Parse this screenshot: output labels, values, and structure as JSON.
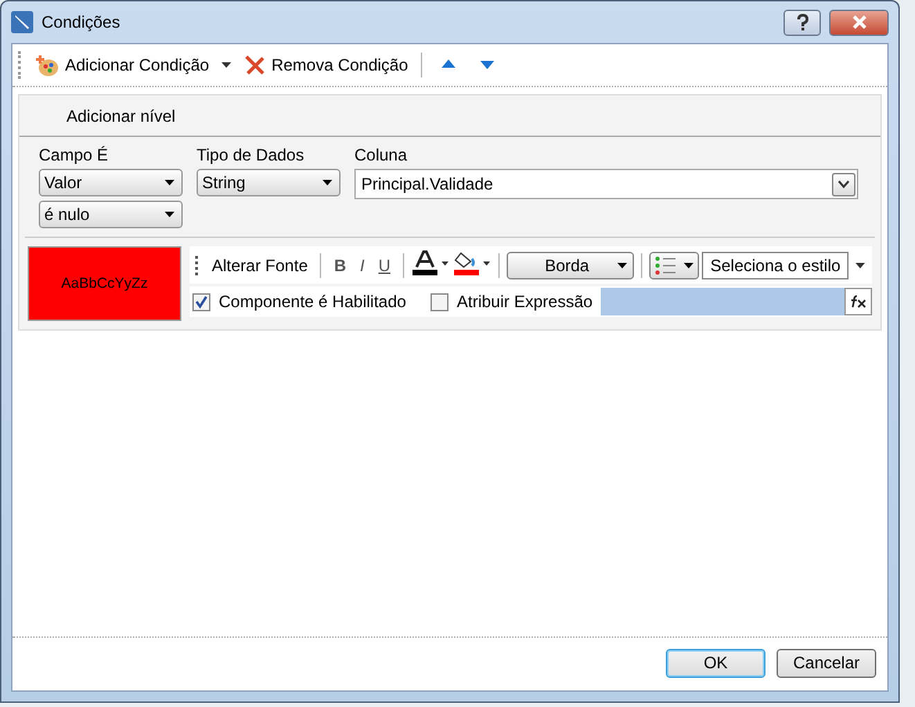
{
  "window": {
    "title": "Condições"
  },
  "toolbar": [
    {
      "kind": "add",
      "label": "Adicionar Condição"
    },
    {
      "kind": "remove",
      "label": "Remova Condição"
    },
    {
      "kind": "up"
    },
    {
      "kind": "down"
    }
  ],
  "level_button": "Adicionar nível",
  "fields": [
    {
      "label": "Campo É",
      "value": "Valor",
      "extra": "é nulo"
    },
    {
      "label": "Tipo de Dados",
      "value": "String"
    },
    {
      "label": "Coluna",
      "value": "Principal.Validade"
    }
  ],
  "preview": {
    "text": "AaBbCcYyZz",
    "color": "#ff0000"
  },
  "format": {
    "font_button": "Alterar Fonte",
    "bold": "B",
    "italic": "I",
    "underline": "U",
    "border": "Borda",
    "style": "Seleciona o estilo"
  },
  "checks": [
    {
      "label": "Componente é Habilitado",
      "checked": true
    },
    {
      "label": "Atribuir Expressão",
      "checked": false
    }
  ],
  "buttons": [
    {
      "label": "OK",
      "default": true
    },
    {
      "label": "Cancelar",
      "default": false
    }
  ]
}
